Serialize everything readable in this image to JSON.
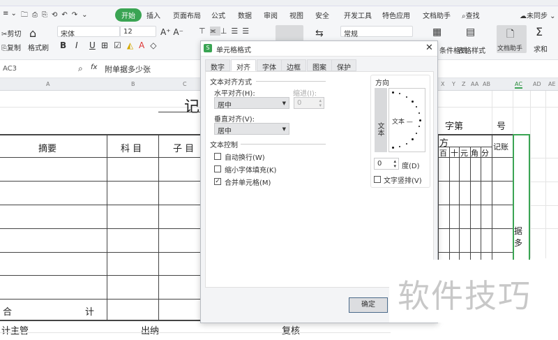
{
  "menu": {
    "items": [
      "开始",
      "插入",
      "页面布局",
      "公式",
      "数据",
      "审阅",
      "视图",
      "安全",
      "开发工具",
      "特色应用",
      "文档助手"
    ],
    "search": "查找",
    "sync": "未同步"
  },
  "toolbar": {
    "cut": "剪切",
    "copy": "复制",
    "format_painter": "格式刷",
    "font": "宋体",
    "size": "12",
    "number_format": "常规",
    "conditional_format": "条件格式",
    "table_style": "表格样式",
    "doc_assistant": "文档助手",
    "sum": "求和",
    "bold": "B",
    "italic": "I",
    "underline": "U"
  },
  "formula_bar": {
    "name_box": "AC3",
    "fx": "fx",
    "content": "附单据多少张"
  },
  "columns": {
    "left": [
      "A",
      "B",
      "C"
    ],
    "right": [
      "X",
      "Y",
      "Z",
      "AA",
      "AB",
      "AC",
      "AD",
      "AE"
    ]
  },
  "sheet": {
    "title": "记",
    "summary": "摘要",
    "subject": "科 目",
    "subitem": "子 目",
    "total_left": "合",
    "total_right": "计",
    "footer": [
      "计主管",
      "出纳",
      "复核"
    ],
    "number_label": "字第",
    "number_suffix": "号",
    "side": "方",
    "digits": [
      "百",
      "十",
      "元",
      "角",
      "分"
    ],
    "bookkeeping": "记账",
    "selected_text": "据多"
  },
  "dialog": {
    "title": "单元格格式",
    "tabs": [
      "数字",
      "对齐",
      "字体",
      "边框",
      "图案",
      "保护"
    ],
    "active_tab": "对齐",
    "text_alignment": "文本对齐方式",
    "horizontal_label": "水平对齐(H):",
    "horizontal_value": "居中",
    "indent_label": "缩进(I):",
    "indent_value": "0",
    "vertical_label": "垂直对齐(V):",
    "vertical_value": "居中",
    "text_control": "文本控制",
    "wrap": {
      "label": "自动换行(W)",
      "checked": false
    },
    "shrink": {
      "label": "缩小字体填充(K)",
      "checked": false
    },
    "merge": {
      "label": "合并单元格(M)",
      "checked": true
    },
    "orientation": "方向",
    "vertical_text": "文本",
    "angle_text": "文本 —",
    "degrees_value": "0",
    "degrees_label": "度(D)",
    "vertical_checkbox": {
      "label": "文字竖排(V)",
      "checked": false
    },
    "ok": "确定"
  },
  "watermark": "软件技巧"
}
